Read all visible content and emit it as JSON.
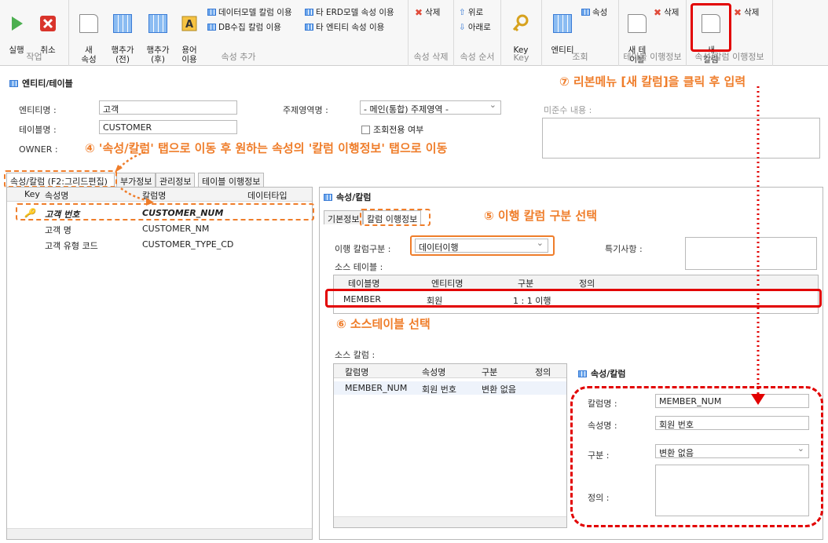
{
  "ribbon": {
    "work": {
      "run": "실행",
      "cancel": "취소",
      "group": "작업"
    },
    "attr_add": {
      "new_attr": "새\n속성",
      "row_before": "행추가\n(전)",
      "row_after": "행추가\n(후)",
      "term": "용어\n이용",
      "dm_column": "데이터모델 칼럼 이용",
      "db_column": "DB수집 칼럼 이용",
      "other_erd": "타 ERD모델 속성 이용",
      "other_entity": "타 엔티티 속성 이용",
      "group": "속성 추가"
    },
    "attr_delete": {
      "delete": "삭제",
      "group": "속성 삭제"
    },
    "attr_order": {
      "up": "위로",
      "down": "아래로",
      "group": "속성 순서"
    },
    "key": {
      "key": "Key",
      "group": "Key"
    },
    "view": {
      "entity": "엔티티",
      "attribute": "속성",
      "group": "조회"
    },
    "table_migration": {
      "new_table": "새 테\n이블",
      "delete": "삭제",
      "group": "테이블 이행정보"
    },
    "column_migration": {
      "new_column": "새\n칼럼",
      "delete": "삭제",
      "group": "속성/칼럼 이행정보"
    }
  },
  "panel_title": "엔티티/테이블",
  "form": {
    "entity_label": "엔티티명 :",
    "entity_value": "고객",
    "table_label": "테이블명 :",
    "table_value": "CUSTOMER",
    "owner_label": "OWNER :",
    "subject_label": "주제영역명 :",
    "subject_value": "- 메인(통합) 주제영역 -",
    "readonly_label": "조회전용 여부",
    "noncompliance_label": "미준수 내용 :"
  },
  "tabs": [
    "속성/칼럼 (F2:그리드편집)",
    "부가정보",
    "관리정보",
    "테이블 이행정보"
  ],
  "attr_grid": {
    "headers": [
      "Key",
      "속성명",
      "칼럼명",
      "데이터타입"
    ],
    "rows": [
      {
        "attr": "고객 번호",
        "column": "CUSTOMER_NUM"
      },
      {
        "attr": "고객 명",
        "column": "CUSTOMER_NM"
      },
      {
        "attr": "고객 유형 코드",
        "column": "CUSTOMER_TYPE_CD"
      }
    ]
  },
  "detail": {
    "title": "속성/칼럼",
    "tabs": [
      "기본정보",
      "칼럼 이행정보"
    ],
    "migration_type_label": "이행 칼럼구분 :",
    "migration_type_value": "데이터이행",
    "special_label": "특기사항 :",
    "source_table_label": "소스 테이블 :",
    "source_table_headers": [
      "테이블명",
      "엔티티명",
      "구분",
      "정의"
    ],
    "source_table_row": {
      "table": "MEMBER",
      "entity": "회원",
      "type": "1 : 1 이행",
      "def": ""
    },
    "source_column_label": "소스 칼럼 :",
    "source_column_headers": [
      "칼럼명",
      "속성명",
      "구분",
      "정의"
    ],
    "source_column_row": {
      "column": "MEMBER_NUM",
      "attr": "회원 번호",
      "type": "변환 없음",
      "def": ""
    }
  },
  "sub_panel": {
    "title": "속성/칼럼",
    "column_label": "칼럼명 :",
    "column_value": "MEMBER_NUM",
    "attr_label": "속성명 :",
    "attr_value": "회원 번호",
    "type_label": "구분 :",
    "type_value": "변환 없음",
    "def_label": "정의 :"
  },
  "annotations": {
    "step4": "④ '속성/칼럼' 탭으로 이동 후 원하는 속성의 '칼럼 이행정보' 탭으로 이동",
    "step5": "⑤ 이행 칼럼 구분 선택",
    "step6": "⑥ 소스테이블 선택",
    "step7": "⑦ 리본메뉴 [새 칼럼]을 클릭 후 입력"
  },
  "colors": {
    "annotation_orange": "#ef7d2a",
    "highlight_red": "#e20000",
    "accent_blue": "#3a7bd5"
  }
}
